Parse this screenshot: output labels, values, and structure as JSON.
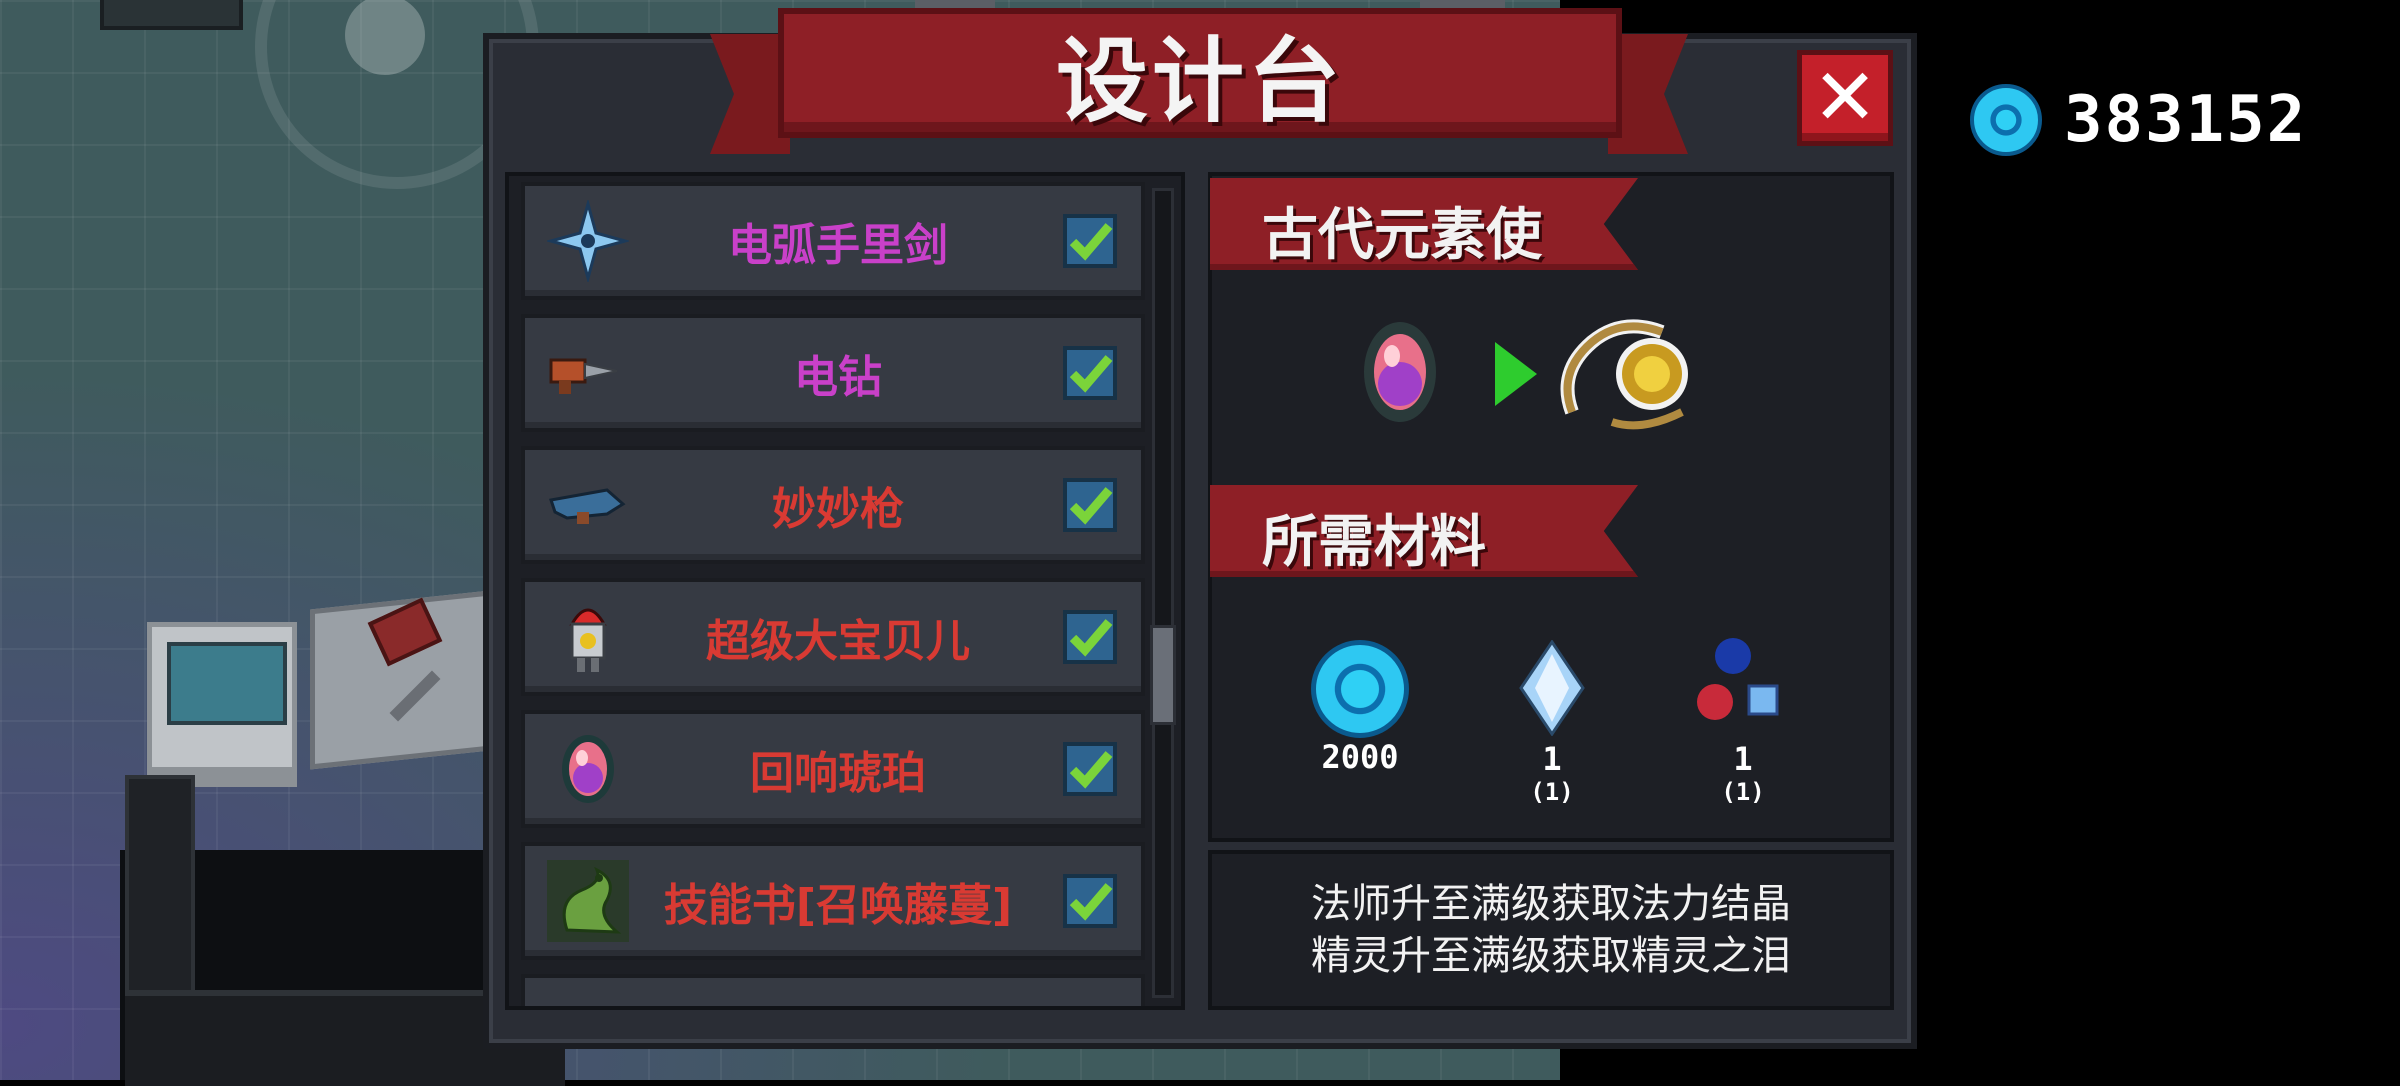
{
  "header": {
    "title": "设计台"
  },
  "currency": {
    "icon": "blue-gem-icon",
    "amount": "383152"
  },
  "blueprint_list": {
    "items": [
      {
        "name": "电弧手里剑",
        "color": "#c940c9",
        "icon": "shuriken-icon",
        "checked": true
      },
      {
        "name": "电钻",
        "color": "#c940c9",
        "icon": "drill-icon",
        "checked": true
      },
      {
        "name": "妙妙枪",
        "color": "#d93a33",
        "icon": "gun-icon",
        "checked": true
      },
      {
        "name": "超级大宝贝儿",
        "color": "#d93a33",
        "icon": "nuke-missile-icon",
        "checked": true
      },
      {
        "name": "回响琥珀",
        "color": "#d93a33",
        "icon": "amber-gem-icon",
        "checked": true
      },
      {
        "name": "技能书[召唤藤蔓]",
        "color": "#d93a33",
        "icon": "vine-dragon-icon",
        "checked": true
      }
    ]
  },
  "detail": {
    "character_title": "古代元素使",
    "materials_title": "所需材料",
    "materials": [
      {
        "icon": "blue-gem-icon",
        "required": "2000",
        "owned": ""
      },
      {
        "icon": "magic-crystal-icon",
        "required": "1",
        "owned": "(1)"
      },
      {
        "icon": "spirit-tear-icon",
        "required": "1",
        "owned": "(1)"
      }
    ],
    "hint_lines": [
      "法师升至满级获取法力结晶",
      "精灵升至满级获取精灵之泪"
    ]
  },
  "colors": {
    "accent_red": "#8e1f26",
    "check_green": "#7bd43a",
    "gem_blue": "#2fd0f5"
  }
}
